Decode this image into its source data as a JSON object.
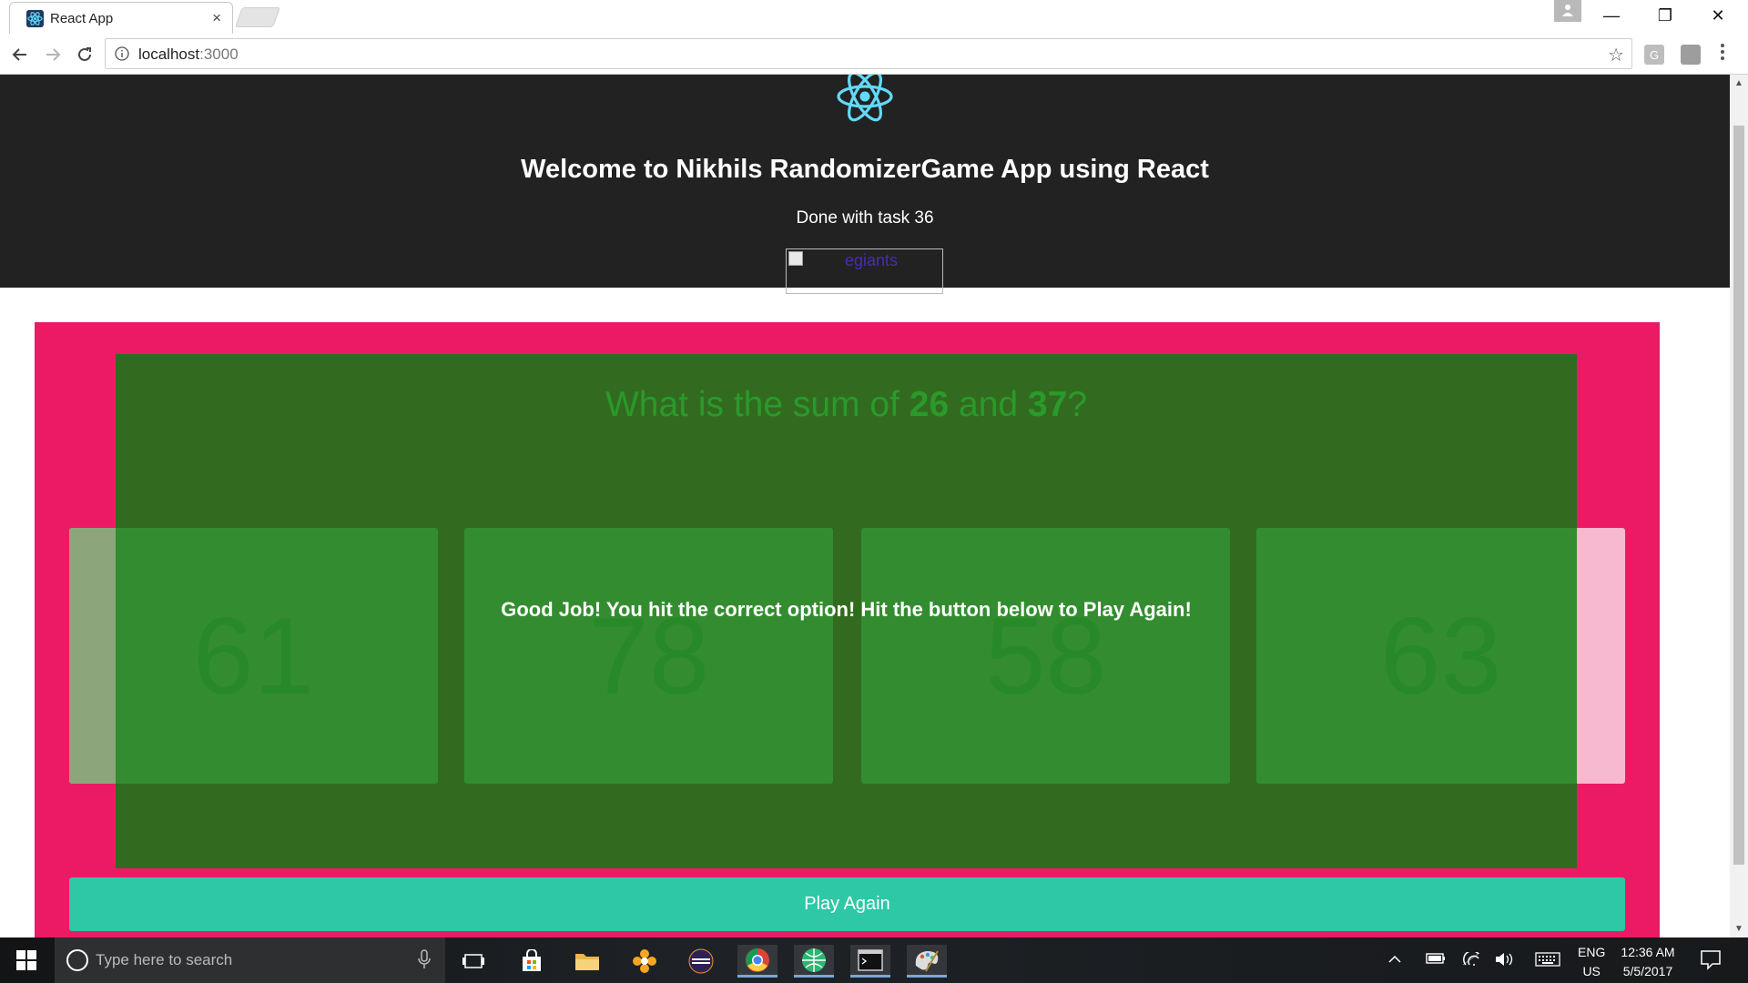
{
  "browser": {
    "tab_title": "React App",
    "tab_close": "×",
    "url_host": "localhost",
    "url_port": ":3000",
    "ext_g": "G",
    "window_minimize": "—",
    "window_restore": "❐",
    "window_close": "✕"
  },
  "header": {
    "title": "Welcome to Nikhils RandomizerGame App using React",
    "subtitle": "Done with task 36",
    "image_alt": "egiants"
  },
  "game": {
    "question_prefix": "What is the sum of ",
    "number_a": "26",
    "question_mid": " and ",
    "number_b": "37",
    "question_suffix": "?",
    "options": [
      "61",
      "78",
      "58",
      "63"
    ],
    "result_message": "Good Job! You hit the correct option! Hit the button below to Play Again!",
    "play_again_label": "Play Again"
  },
  "taskbar": {
    "search_placeholder": "Type here to search",
    "lang_line1": "ENG",
    "lang_line2": "US",
    "time": "12:36 AM",
    "date": "5/5/2017"
  },
  "colors": {
    "header_bg": "#222222",
    "panel_bg": "#ec1a64",
    "overlay_bg": "#167816",
    "button_bg": "#2ec8a6",
    "option_bg": "#f7b9d0"
  }
}
